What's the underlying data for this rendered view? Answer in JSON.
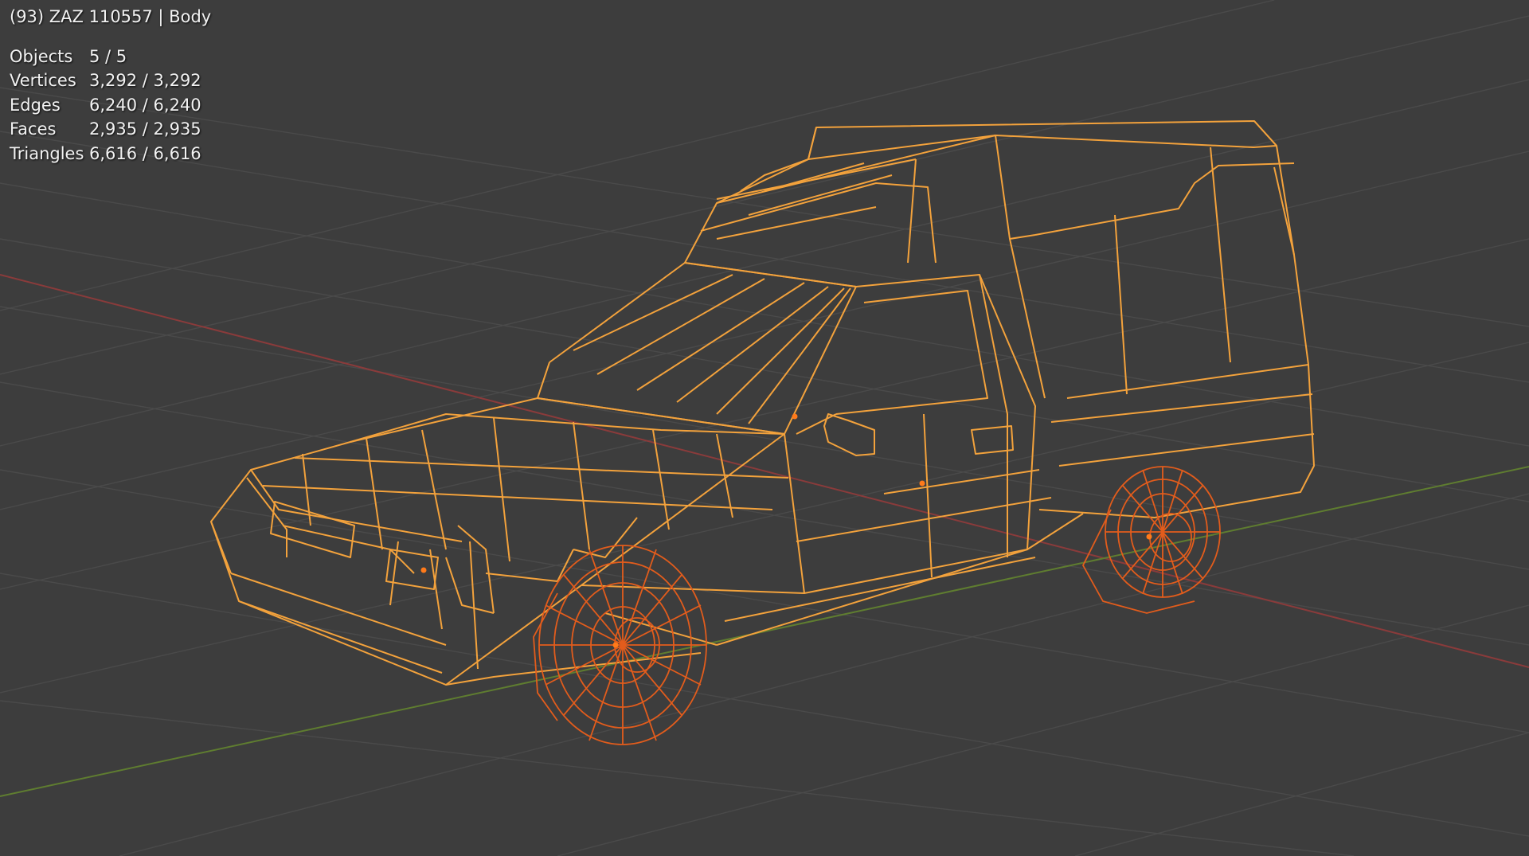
{
  "viewport": {
    "header": {
      "frame": "(93)",
      "collection": "ZAZ 110557",
      "separator": "|",
      "active_object": "Body",
      "text": "(93) ZAZ 110557 | Body"
    },
    "statistics": [
      {
        "label": "Objects",
        "value": "5 / 5"
      },
      {
        "label": "Vertices",
        "value": "3,292 / 3,292"
      },
      {
        "label": "Edges",
        "value": "6,240 / 6,240"
      },
      {
        "label": "Faces",
        "value": "2,935 / 2,935"
      },
      {
        "label": "Triangles",
        "value": "6,616 / 6,616"
      }
    ],
    "colors": {
      "background": "#3d3d3d",
      "grid": "#4a4a4a",
      "x_axis": "#8a3b3b",
      "y_axis": "#5f7d30",
      "body_wire": "#f3a23c",
      "wheel_wire": "#e25c1c",
      "origin_dot": "#ff7a1a"
    },
    "objects": [
      {
        "name": "body",
        "icon": "car-body-wireframe"
      },
      {
        "name": "front-left-wheel",
        "icon": "wheel-wireframe"
      },
      {
        "name": "rear-left-wheel",
        "icon": "wheel-wireframe"
      },
      {
        "name": "mirror",
        "icon": "mirror-wireframe"
      },
      {
        "name": "handle",
        "icon": "handle-wireframe"
      }
    ]
  }
}
